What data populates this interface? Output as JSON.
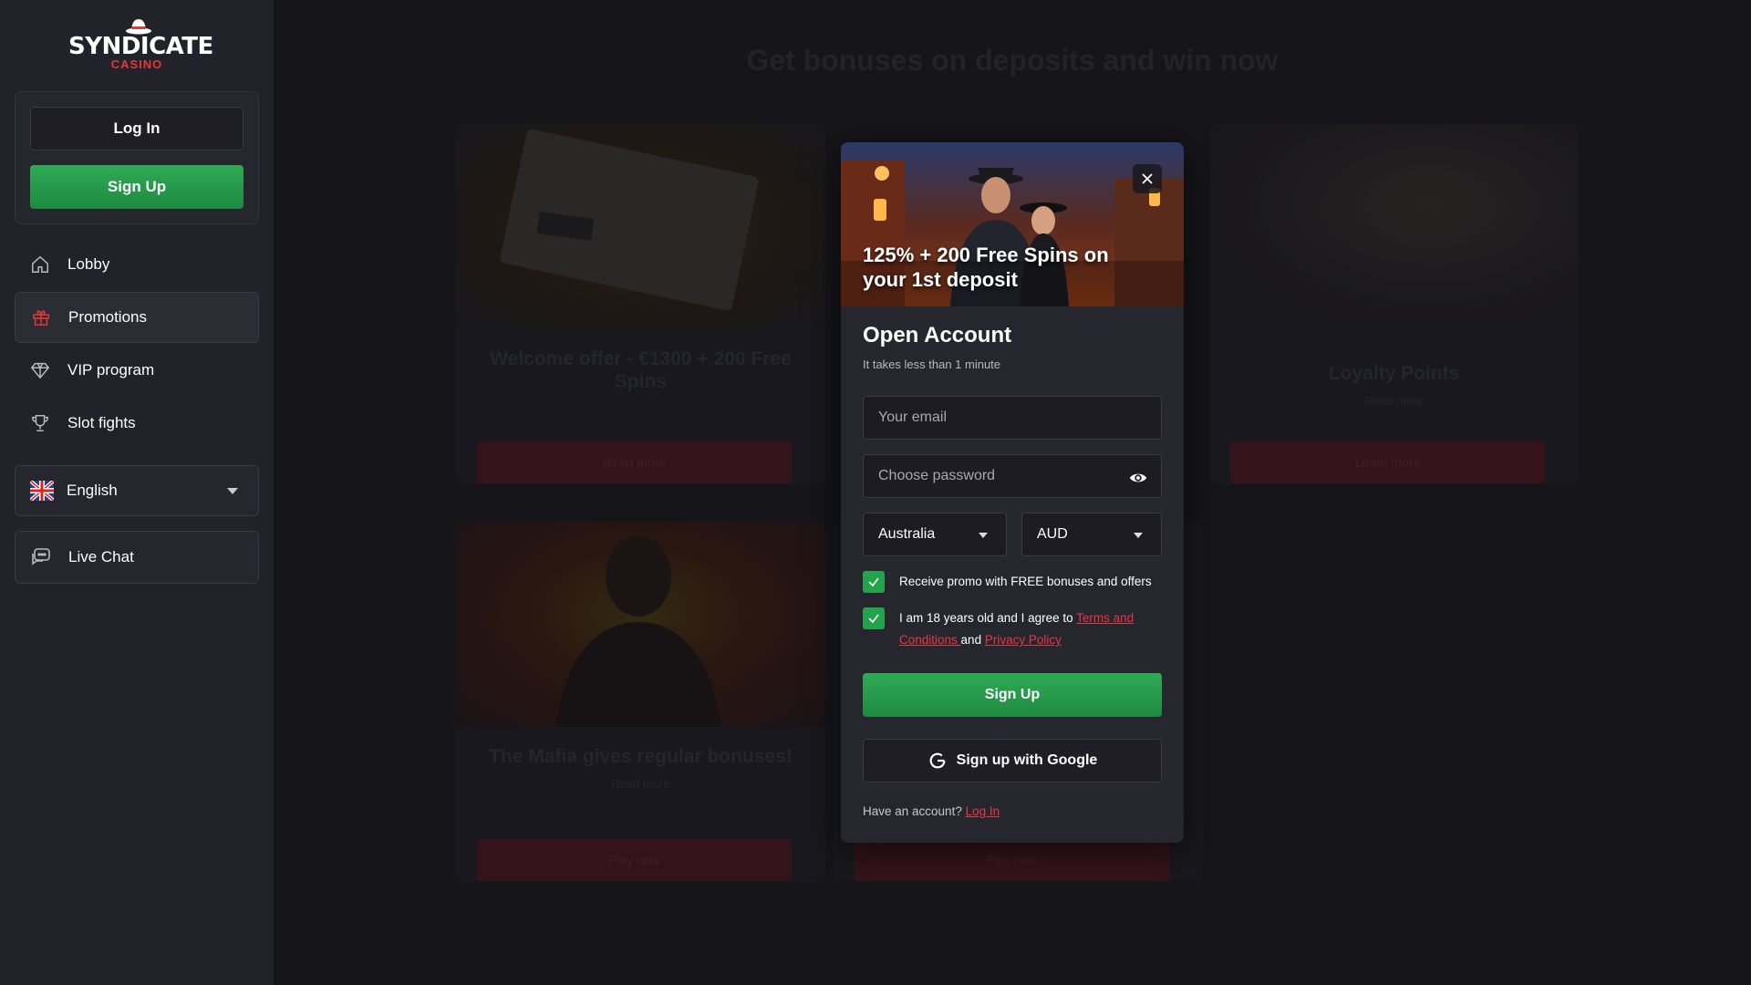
{
  "logo": {
    "brand": "SYNDICATE",
    "sub": "CASINO"
  },
  "auth": {
    "login_label": "Log In",
    "signup_label": "Sign Up"
  },
  "nav": {
    "items": [
      {
        "label": "Lobby",
        "icon": "home-icon"
      },
      {
        "label": "Promotions",
        "icon": "gift-icon",
        "active": true
      },
      {
        "label": "VIP program",
        "icon": "diamond-icon"
      },
      {
        "label": "Slot fights",
        "icon": "trophy-icon"
      }
    ]
  },
  "language": {
    "label": "English",
    "icon": "uk-flag-icon"
  },
  "live_chat": {
    "label": "Live Chat",
    "icon": "chat-icon"
  },
  "background": {
    "title": "Get bonuses on deposits and win now",
    "cards": [
      {
        "title": "Welcome offer - €1300 + 200 Free Spins",
        "button": "Read more"
      },
      {
        "title": "Loyalty Points",
        "read_more": "Read more",
        "button": "Learn more"
      },
      {
        "title": "The Mafia gives regular bonuses!",
        "read_more": "Read more",
        "button": "Play now"
      },
      {
        "title": "",
        "button": "Play now"
      }
    ]
  },
  "modal": {
    "banner_text": "125% + 200 Free Spins on your 1st deposit",
    "title": "Open Account",
    "subtitle": "It takes less than 1 minute",
    "email_placeholder": "Your email",
    "password_placeholder": "Choose password",
    "country": "Australia",
    "currency": "AUD",
    "promo_label": "Receive promo with FREE bonuses and offers",
    "age_prefix": "I am 18 years old and I agree to ",
    "terms_label": "Terms and Conditions ",
    "and_label": " and ",
    "privacy_label": "Privacy Policy",
    "signup_label": "Sign Up",
    "google_label": "Sign up with Google",
    "have_account": "Have an account? ",
    "login_link": "Log In"
  },
  "colors": {
    "accent_green": "#24a24c",
    "accent_red": "#e53945",
    "sidebar_bg": "#22222a"
  }
}
